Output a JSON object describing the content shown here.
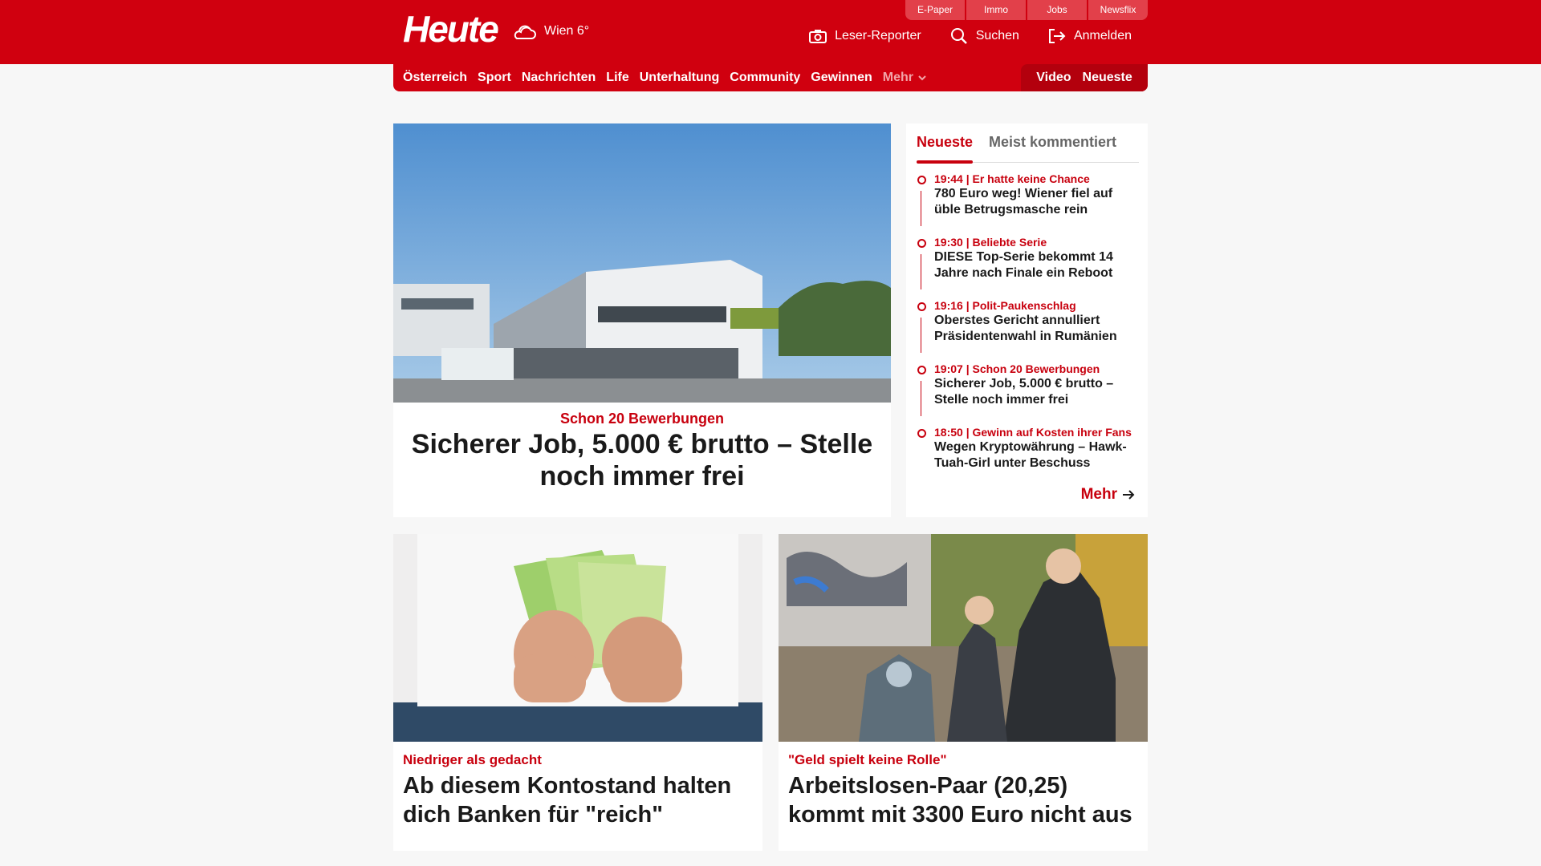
{
  "header": {
    "logo": "Heute",
    "weather": "Wien 6°",
    "top_links": [
      "E-Paper",
      "Immo",
      "Jobs",
      "Newsflix"
    ],
    "actions": {
      "reporter": "Leser-Reporter",
      "search": "Suchen",
      "login": "Anmelden"
    }
  },
  "nav": {
    "items": [
      "Österreich",
      "Sport",
      "Nachrichten",
      "Life",
      "Unterhaltung",
      "Community",
      "Gewinnen"
    ],
    "more": "Mehr",
    "video": "Video",
    "latest": "Neueste"
  },
  "hero": {
    "kicker": "Schon 20 Bewerbungen",
    "title": "Sicherer Job, 5.000 € brutto – Stelle noch immer frei"
  },
  "sidebar": {
    "tabs": [
      "Neueste",
      "Meist kommentiert"
    ],
    "items": [
      {
        "meta": "19:44 | Er hatte keine Chance",
        "title": "780 Euro weg! Wiener fiel auf üble Betrugsmasche rein"
      },
      {
        "meta": "19:30 | Beliebte Serie",
        "title": "DIESE Top-Serie bekommt 14 Jahre nach Finale ein Reboot"
      },
      {
        "meta": "19:16 | Polit-Paukenschlag",
        "title": "Oberstes Gericht annulliert Präsidentenwahl in Rumänien"
      },
      {
        "meta": "19:07 | Schon 20 Bewerbungen",
        "title": "Sicherer Job, 5.000 € brutto – Stelle noch immer frei"
      },
      {
        "meta": "18:50 | Gewinn auf Kosten ihrer Fans",
        "title": "Wegen Kryptowährung – Hawk-Tuah-Girl unter Beschuss"
      }
    ],
    "more": "Mehr"
  },
  "cards": [
    {
      "kicker": "Niedriger als gedacht",
      "title": "Ab diesem Kontostand halten dich Banken für \"reich\""
    },
    {
      "kicker": "\"Geld spielt keine Rolle\"",
      "title": "Arbeitslosen-Paar (20,25) kommt mit 3300 Euro nicht aus"
    }
  ]
}
